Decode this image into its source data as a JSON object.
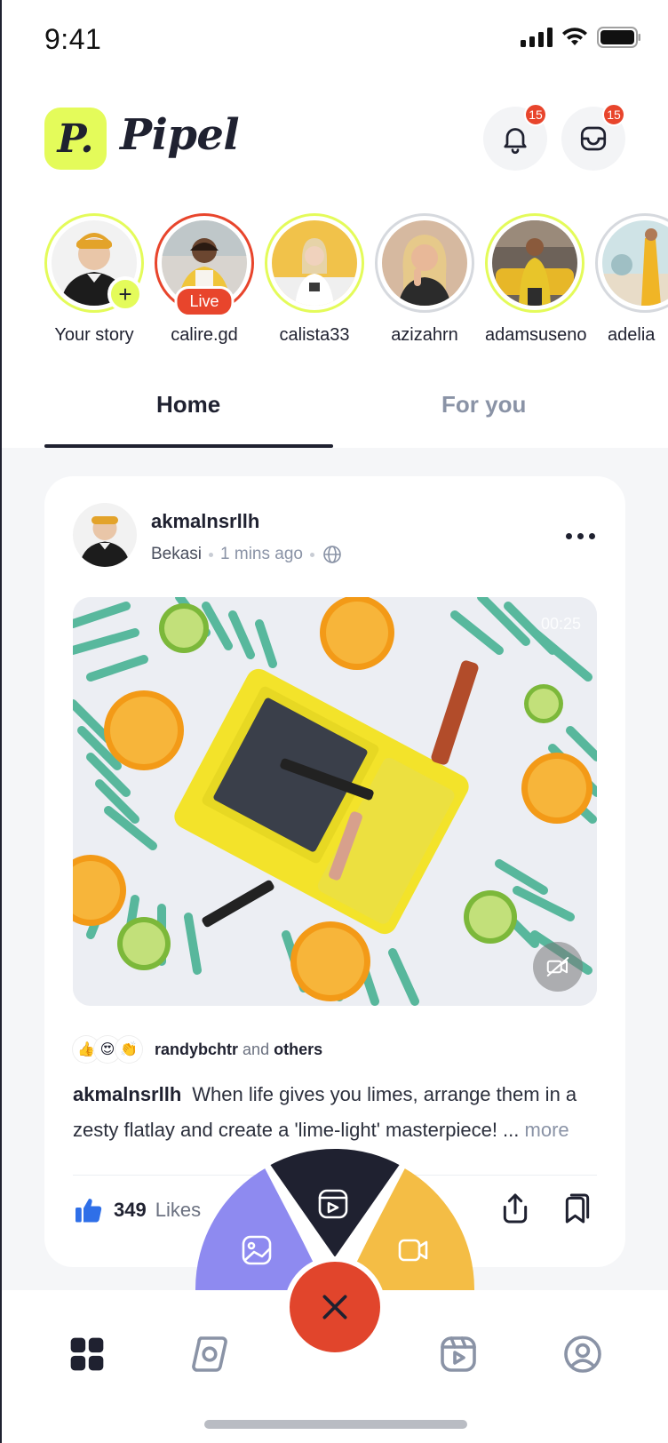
{
  "status_bar": {
    "time": "9:41"
  },
  "header": {
    "logo_letter": "P.",
    "app_name": "Pipel",
    "notifications_badge": "15",
    "inbox_badge": "15"
  },
  "stories": [
    {
      "name": "Your story",
      "ring": "new",
      "badge": "+"
    },
    {
      "name": "calire.gd",
      "ring": "live",
      "badge": "Live"
    },
    {
      "name": "calista33",
      "ring": "new"
    },
    {
      "name": "azizahrn",
      "ring": "seen"
    },
    {
      "name": "adamsuseno",
      "ring": "new"
    },
    {
      "name": "adelia",
      "ring": "seen"
    }
  ],
  "tabs": {
    "home": "Home",
    "for_you": "For you",
    "active": "Home"
  },
  "post": {
    "username": "akmalnsrllh",
    "location": "Bekasi",
    "time_ago": "1 mins ago",
    "video_duration": "00:25",
    "reactions_emojis": [
      "👍",
      "😍",
      "👏"
    ],
    "reaction_user": "randybchtr",
    "reaction_and": "and",
    "reaction_others": "others",
    "caption_user": "akmalnsrllh",
    "caption_text": "When life gives you limes, arrange them in a zesty flatlay and create a 'lime-light' masterpiece! ...",
    "caption_more": "more",
    "likes_count": "349",
    "likes_label": "Likes"
  },
  "colors": {
    "brand_lime": "#e4fb5a",
    "accent_red": "#e1452c",
    "fan_purple": "#8e8af0",
    "fan_dark": "#1f2130",
    "fan_yellow": "#f4bd45"
  },
  "fan_menu": {
    "items": [
      {
        "icon": "image-icon",
        "color": "#8e8af0"
      },
      {
        "icon": "reels-icon",
        "color": "#1f2130"
      },
      {
        "icon": "video-camera-icon",
        "color": "#f4bd45"
      }
    ]
  },
  "bottom_nav": {
    "items": [
      "grid-icon",
      "explore-icon",
      "close-icon",
      "reels-icon",
      "profile-icon"
    ],
    "active": "grid-icon"
  }
}
